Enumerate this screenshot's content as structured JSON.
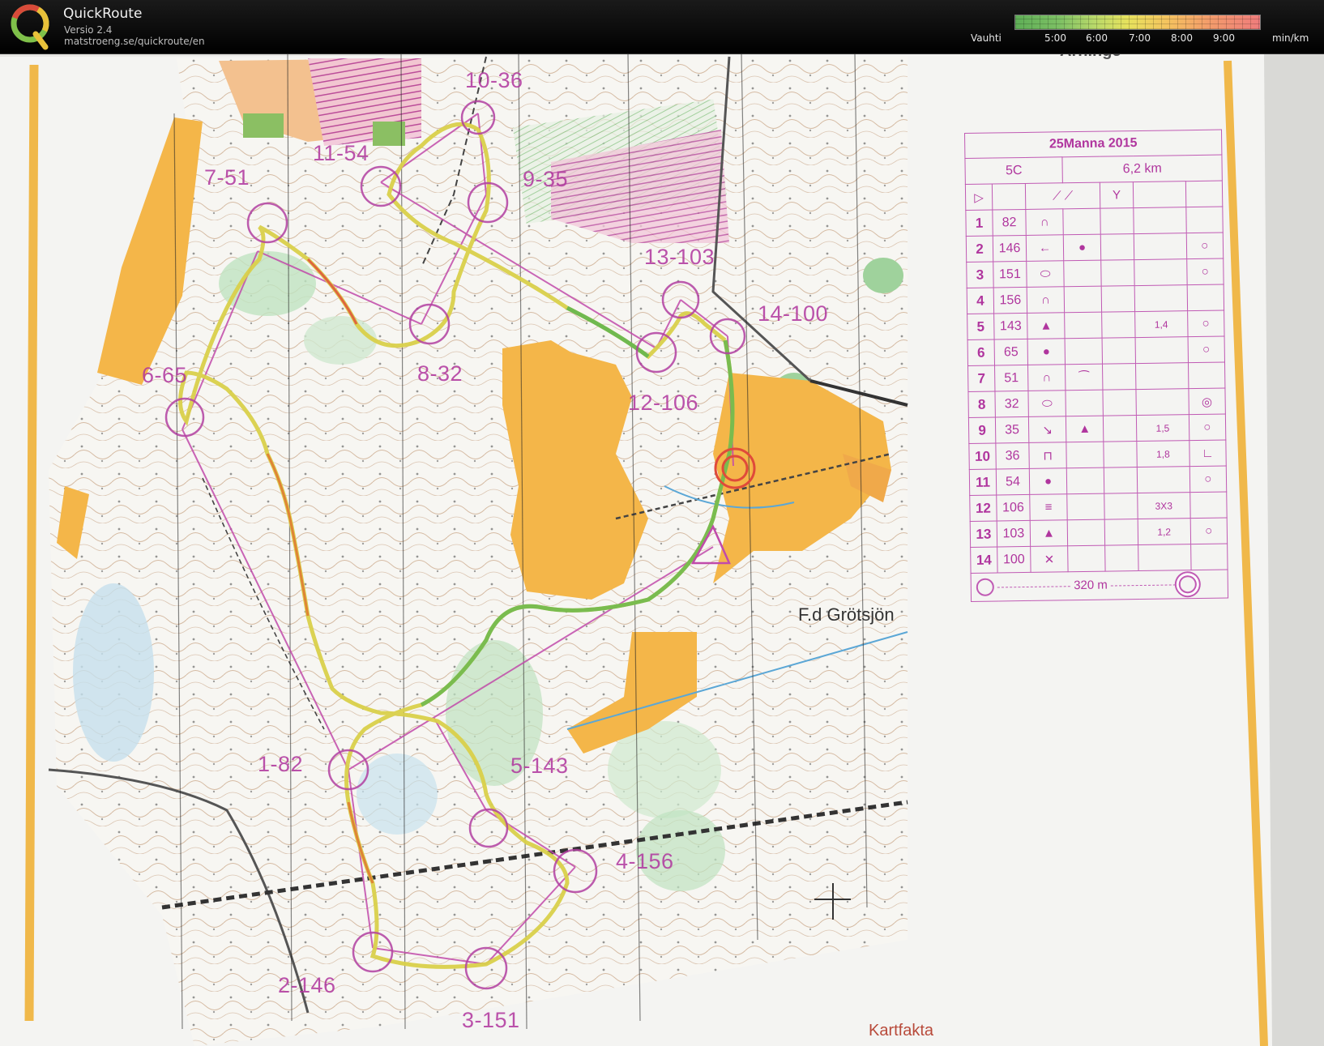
{
  "app": {
    "title": "QuickRoute",
    "version": "Versio 2.4",
    "url": "matstroeng.se/quickroute/en"
  },
  "pace_legend": {
    "name": "Vauhti",
    "ticks": [
      "5:00",
      "6:00",
      "7:00",
      "8:00",
      "9:00"
    ],
    "unit": "min/km",
    "colors": [
      "#5fae57",
      "#b7d86a",
      "#e7e25d",
      "#f39e6a",
      "#ef7c7c"
    ]
  },
  "map": {
    "control_labels": [
      "1-82",
      "2-146",
      "3-151",
      "4-156",
      "5-143",
      "6-65",
      "7-51",
      "8-32",
      "9-35",
      "10-36",
      "11-54",
      "12-106",
      "13-103",
      "14-100"
    ],
    "place_names": [
      "F.d Grötsjön",
      "Kartfakta",
      "Arninge"
    ]
  },
  "description_sheet": {
    "event": "25Manna 2015",
    "class": "5C",
    "length": "6,2 km",
    "rows": [
      {
        "n": "1",
        "code": "82",
        "feature": "∩",
        "extra": "",
        "dim": "",
        "detail": ""
      },
      {
        "n": "2",
        "code": "146",
        "feature": "←",
        "extra": "●",
        "dim": "",
        "detail": "○"
      },
      {
        "n": "3",
        "code": "151",
        "feature": "⬭",
        "extra": "",
        "dim": "",
        "detail": "○"
      },
      {
        "n": "4",
        "code": "156",
        "feature": "∩",
        "extra": "",
        "dim": "",
        "detail": ""
      },
      {
        "n": "5",
        "code": "143",
        "feature": "▲",
        "extra": "",
        "dim": "1,4",
        "detail": "○"
      },
      {
        "n": "6",
        "code": "65",
        "feature": "●",
        "extra": "",
        "dim": "",
        "detail": "○"
      },
      {
        "n": "7",
        "code": "51",
        "feature": "∩",
        "extra": "⁀",
        "dim": "",
        "detail": ""
      },
      {
        "n": "8",
        "code": "32",
        "feature": "⬭",
        "extra": "",
        "dim": "",
        "detail": "◎"
      },
      {
        "n": "9",
        "code": "35",
        "feature": "↘",
        "extra": "▲",
        "dim": "1,5",
        "detail": "○"
      },
      {
        "n": "10",
        "code": "36",
        "feature": "⊓",
        "extra": "",
        "dim": "1,8",
        "detail": "∟"
      },
      {
        "n": "11",
        "code": "54",
        "feature": "●",
        "extra": "",
        "dim": "",
        "detail": "○"
      },
      {
        "n": "12",
        "code": "106",
        "feature": "≡",
        "extra": "",
        "dim": "3X3",
        "detail": ""
      },
      {
        "n": "13",
        "code": "103",
        "feature": "▲",
        "extra": "",
        "dim": "1,2",
        "detail": "○"
      },
      {
        "n": "14",
        "code": "100",
        "feature": "✕",
        "extra": "",
        "dim": "",
        "detail": ""
      }
    ],
    "finish_distance": "320 m"
  }
}
